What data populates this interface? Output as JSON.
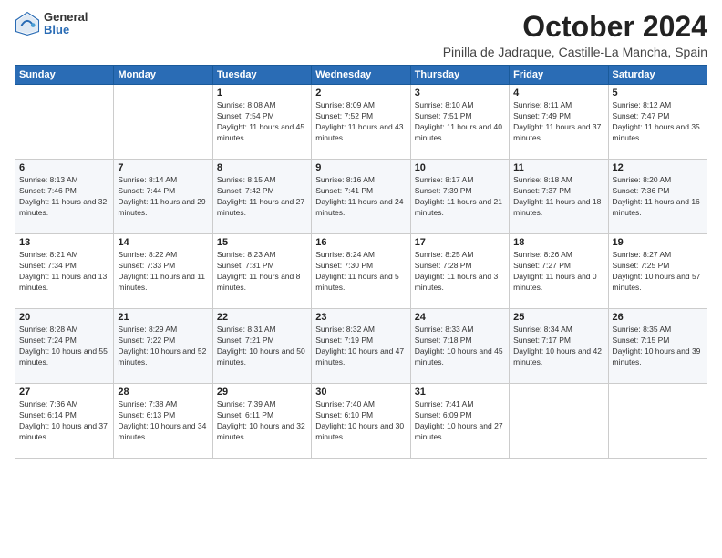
{
  "header": {
    "logo_general": "General",
    "logo_blue": "Blue",
    "month_title": "October 2024",
    "location": "Pinilla de Jadraque, Castille-La Mancha, Spain"
  },
  "weekdays": [
    "Sunday",
    "Monday",
    "Tuesday",
    "Wednesday",
    "Thursday",
    "Friday",
    "Saturday"
  ],
  "weeks": [
    [
      {
        "day": "",
        "info": ""
      },
      {
        "day": "",
        "info": ""
      },
      {
        "day": "1",
        "info": "Sunrise: 8:08 AM\nSunset: 7:54 PM\nDaylight: 11 hours and 45 minutes."
      },
      {
        "day": "2",
        "info": "Sunrise: 8:09 AM\nSunset: 7:52 PM\nDaylight: 11 hours and 43 minutes."
      },
      {
        "day": "3",
        "info": "Sunrise: 8:10 AM\nSunset: 7:51 PM\nDaylight: 11 hours and 40 minutes."
      },
      {
        "day": "4",
        "info": "Sunrise: 8:11 AM\nSunset: 7:49 PM\nDaylight: 11 hours and 37 minutes."
      },
      {
        "day": "5",
        "info": "Sunrise: 8:12 AM\nSunset: 7:47 PM\nDaylight: 11 hours and 35 minutes."
      }
    ],
    [
      {
        "day": "6",
        "info": "Sunrise: 8:13 AM\nSunset: 7:46 PM\nDaylight: 11 hours and 32 minutes."
      },
      {
        "day": "7",
        "info": "Sunrise: 8:14 AM\nSunset: 7:44 PM\nDaylight: 11 hours and 29 minutes."
      },
      {
        "day": "8",
        "info": "Sunrise: 8:15 AM\nSunset: 7:42 PM\nDaylight: 11 hours and 27 minutes."
      },
      {
        "day": "9",
        "info": "Sunrise: 8:16 AM\nSunset: 7:41 PM\nDaylight: 11 hours and 24 minutes."
      },
      {
        "day": "10",
        "info": "Sunrise: 8:17 AM\nSunset: 7:39 PM\nDaylight: 11 hours and 21 minutes."
      },
      {
        "day": "11",
        "info": "Sunrise: 8:18 AM\nSunset: 7:37 PM\nDaylight: 11 hours and 18 minutes."
      },
      {
        "day": "12",
        "info": "Sunrise: 8:20 AM\nSunset: 7:36 PM\nDaylight: 11 hours and 16 minutes."
      }
    ],
    [
      {
        "day": "13",
        "info": "Sunrise: 8:21 AM\nSunset: 7:34 PM\nDaylight: 11 hours and 13 minutes."
      },
      {
        "day": "14",
        "info": "Sunrise: 8:22 AM\nSunset: 7:33 PM\nDaylight: 11 hours and 11 minutes."
      },
      {
        "day": "15",
        "info": "Sunrise: 8:23 AM\nSunset: 7:31 PM\nDaylight: 11 hours and 8 minutes."
      },
      {
        "day": "16",
        "info": "Sunrise: 8:24 AM\nSunset: 7:30 PM\nDaylight: 11 hours and 5 minutes."
      },
      {
        "day": "17",
        "info": "Sunrise: 8:25 AM\nSunset: 7:28 PM\nDaylight: 11 hours and 3 minutes."
      },
      {
        "day": "18",
        "info": "Sunrise: 8:26 AM\nSunset: 7:27 PM\nDaylight: 11 hours and 0 minutes."
      },
      {
        "day": "19",
        "info": "Sunrise: 8:27 AM\nSunset: 7:25 PM\nDaylight: 10 hours and 57 minutes."
      }
    ],
    [
      {
        "day": "20",
        "info": "Sunrise: 8:28 AM\nSunset: 7:24 PM\nDaylight: 10 hours and 55 minutes."
      },
      {
        "day": "21",
        "info": "Sunrise: 8:29 AM\nSunset: 7:22 PM\nDaylight: 10 hours and 52 minutes."
      },
      {
        "day": "22",
        "info": "Sunrise: 8:31 AM\nSunset: 7:21 PM\nDaylight: 10 hours and 50 minutes."
      },
      {
        "day": "23",
        "info": "Sunrise: 8:32 AM\nSunset: 7:19 PM\nDaylight: 10 hours and 47 minutes."
      },
      {
        "day": "24",
        "info": "Sunrise: 8:33 AM\nSunset: 7:18 PM\nDaylight: 10 hours and 45 minutes."
      },
      {
        "day": "25",
        "info": "Sunrise: 8:34 AM\nSunset: 7:17 PM\nDaylight: 10 hours and 42 minutes."
      },
      {
        "day": "26",
        "info": "Sunrise: 8:35 AM\nSunset: 7:15 PM\nDaylight: 10 hours and 39 minutes."
      }
    ],
    [
      {
        "day": "27",
        "info": "Sunrise: 7:36 AM\nSunset: 6:14 PM\nDaylight: 10 hours and 37 minutes."
      },
      {
        "day": "28",
        "info": "Sunrise: 7:38 AM\nSunset: 6:13 PM\nDaylight: 10 hours and 34 minutes."
      },
      {
        "day": "29",
        "info": "Sunrise: 7:39 AM\nSunset: 6:11 PM\nDaylight: 10 hours and 32 minutes."
      },
      {
        "day": "30",
        "info": "Sunrise: 7:40 AM\nSunset: 6:10 PM\nDaylight: 10 hours and 30 minutes."
      },
      {
        "day": "31",
        "info": "Sunrise: 7:41 AM\nSunset: 6:09 PM\nDaylight: 10 hours and 27 minutes."
      },
      {
        "day": "",
        "info": ""
      },
      {
        "day": "",
        "info": ""
      }
    ]
  ]
}
